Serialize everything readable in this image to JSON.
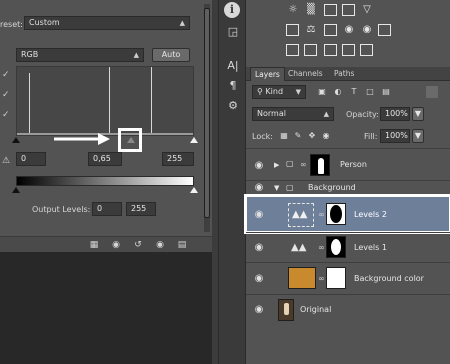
{
  "properties": {
    "preset_label": "reset:",
    "preset_value": "Custom",
    "channel_value": "RGB",
    "auto_label": "Auto",
    "input_black": "0",
    "input_gamma": "0,65",
    "input_white": "255",
    "output_label": "Output Levels:",
    "output_black": "0",
    "output_white": "255"
  },
  "toolstrip": {
    "tools": [
      "info-icon",
      "character-icon",
      "paragraph-icon",
      "tool-presets-icon"
    ]
  },
  "layers_panel": {
    "tabs": [
      "Layers",
      "Channels",
      "Paths"
    ],
    "filter_label": "Kind",
    "blend_mode": "Normal",
    "opacity_label": "Opacity:",
    "opacity_value": "100%",
    "lock_label": "Lock:",
    "fill_label": "Fill:",
    "fill_value": "100%",
    "layers": [
      {
        "name": "Person",
        "type": "group"
      },
      {
        "name": "Background",
        "type": "group-open"
      },
      {
        "name": "Levels 2",
        "type": "adjustment",
        "selected": true
      },
      {
        "name": "Levels 1",
        "type": "adjustment"
      },
      {
        "name": "Background color",
        "type": "fill"
      },
      {
        "name": "Original",
        "type": "image"
      }
    ]
  },
  "colors": {
    "panel": "#535353",
    "selected_layer": "#6d7f99",
    "callout": "#ffffff",
    "fill_layer_swatch": "#c98a2e"
  }
}
